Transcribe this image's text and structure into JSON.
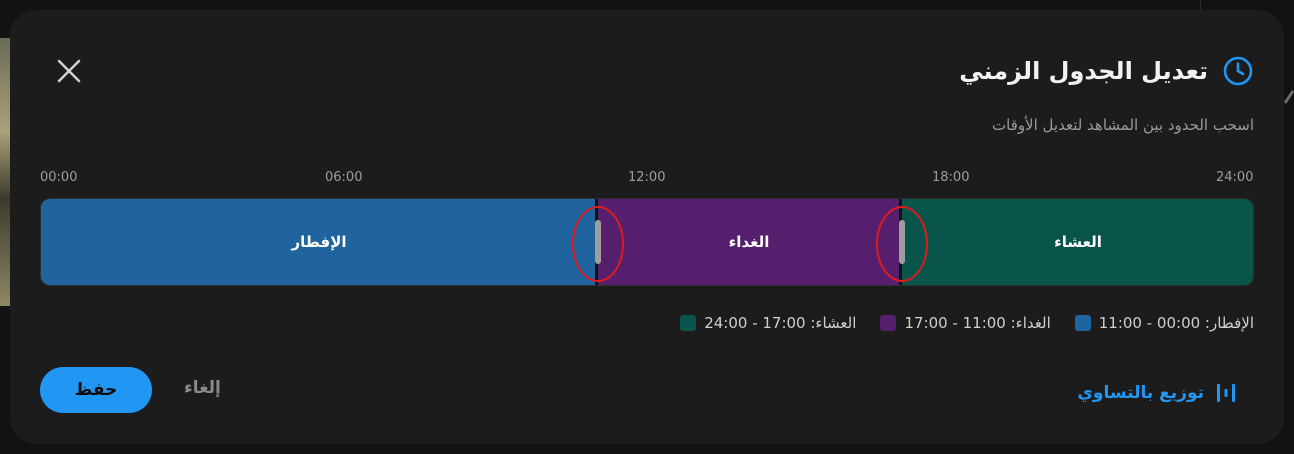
{
  "dialog": {
    "title": "تعديل الجدول الزمني",
    "subtitle": "اسحب الحدود بين المشاهد لتعديل الأوقات",
    "close_icon": "close-icon",
    "title_icon": "clock-icon"
  },
  "timeline": {
    "ticks": [
      "00:00",
      "06:00",
      "12:00",
      "18:00",
      "24:00"
    ],
    "segments": [
      {
        "label": "الإفطار",
        "color": "#1f649e",
        "start": "00:00",
        "end": "11:00"
      },
      {
        "label": "الغداء",
        "color": "#561f6e",
        "start": "11:00",
        "end": "17:00"
      },
      {
        "label": "العشاء",
        "color": "#0a554b",
        "start": "17:00",
        "end": "24:00"
      }
    ]
  },
  "legend": [
    {
      "text": "الإفطار: 00:00 - 11:00",
      "color": "#1f649e"
    },
    {
      "text": "الغداء: 11:00 - 17:00",
      "color": "#561f6e"
    },
    {
      "text": "العشاء: 17:00 - 24:00",
      "color": "#0a554b"
    }
  ],
  "actions": {
    "save_label": "حفظ",
    "cancel_label": "إلغاء",
    "distribute_label": "توزيع بالتساوي",
    "distribute_icon": "equalizer-icon"
  },
  "colors": {
    "accent": "#2196f3",
    "highlight": "#e11b1b"
  }
}
